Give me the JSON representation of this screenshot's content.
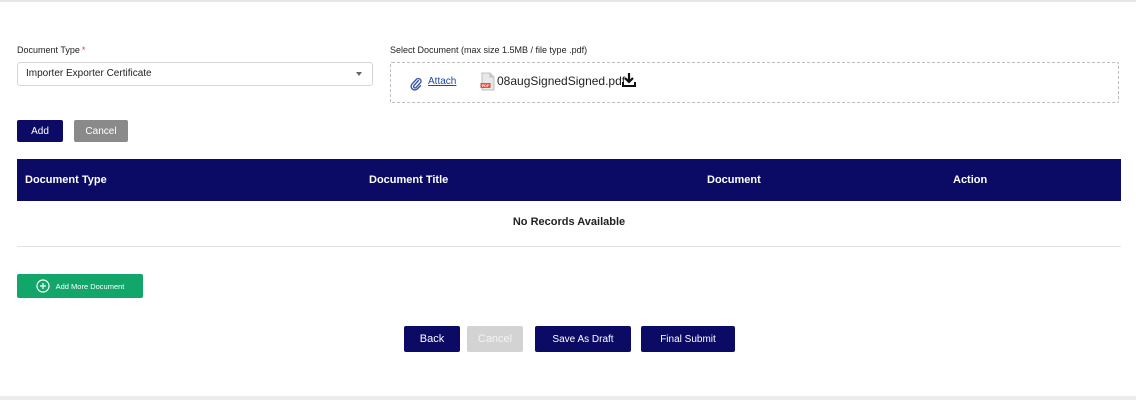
{
  "form": {
    "document_type_label": "Document Type",
    "required_mark": "*",
    "document_type_value": "Importer Exporter Certificate",
    "select_document_label": "Select Document (max size 1.5MB / file type .pdf)",
    "attach_label": "Attach",
    "file_name": "08augSignedSigned.pdf",
    "add_label": "Add",
    "cancel_label": "Cancel"
  },
  "table": {
    "columns": [
      "Document Type",
      "Document Title",
      "Document",
      "Action"
    ],
    "empty_message": "No Records Available"
  },
  "actions": {
    "add_more_label": "Add More Document",
    "back_label": "Back",
    "cancel_label": "Cancel",
    "save_draft_label": "Save As Draft",
    "final_submit_label": "Final Submit"
  },
  "colors": {
    "primary_navy": "#0b0b66",
    "success_green": "#13a66a",
    "required_red": "#e53935",
    "link_blue": "#1f47a8"
  },
  "icons": [
    "paperclip-icon",
    "pdf-file-icon",
    "download-icon",
    "chevron-down-icon",
    "plus-circle-icon"
  ]
}
